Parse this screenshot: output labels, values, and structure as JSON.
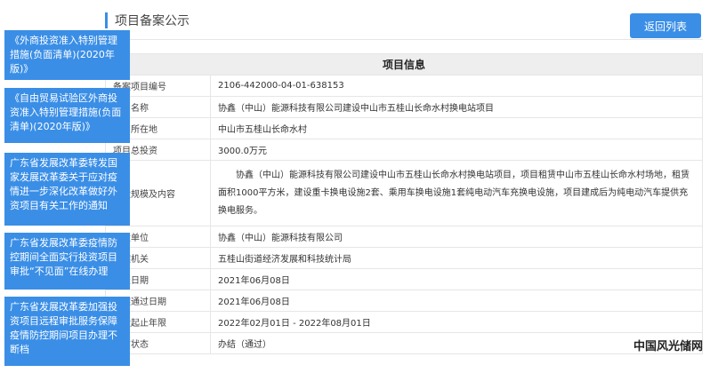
{
  "header": {
    "title": "项目备案公示"
  },
  "back_button": {
    "label": "返回列表"
  },
  "table": {
    "title": "项目信息",
    "rows": [
      {
        "label": "备案项目编号",
        "value": "2106-442000-04-01-638153"
      },
      {
        "label": "项目名称",
        "value": "协鑫（中山）能源科技有限公司建设中山市五桂山长命水村换电站项目"
      },
      {
        "label": "项目所在地",
        "value": "中山市五桂山长命水村"
      },
      {
        "label": "项目总投资",
        "value": "3000.0万元"
      },
      {
        "label": "建设规模及内容",
        "value": "协鑫（中山）能源科技有限公司建设中山市五桂山长命水村换电站项目，项目租赁中山市五桂山长命水村场地，租赁面积1000平方米，建设重卡换电设施2套、乘用车换电设施1套纯电动汽车充换电设施，项目建成后为纯电动汽车提供充换电服务。"
      },
      {
        "label": "建设单位",
        "value": "协鑫（中山）能源科技有限公司"
      },
      {
        "label": "备案机关",
        "value": "五桂山街道经济发展和科技统计局"
      },
      {
        "label": "申报日期",
        "value": "2021年06月08日"
      },
      {
        "label": "备案通过日期",
        "value": "2021年06月08日"
      },
      {
        "label": "建设起止年限",
        "value": "2022年02月01日 - 2022年08月01日"
      },
      {
        "label": "当前状态",
        "value": "办结（通过）"
      }
    ]
  },
  "sidebar": {
    "items": [
      {
        "label": "《外商投资准入特别管理措施(负面清单)(2020年版)》"
      },
      {
        "label": "《自由贸易试验区外商投资准入特别管理措施(负面清单)(2020年版)》"
      },
      {
        "label": "广东省发展改革委转发国家发展改革委关于应对疫情进一步深化改革做好外资项目有关工作的通知"
      },
      {
        "label": "广东省发展改革委疫情防控期间全面实行投资项目审批“不见面”在线办理"
      },
      {
        "label": "广东省发展改革委加强投资项目远程审批服务保障疫情防控期间项目办理不断档"
      }
    ]
  },
  "watermark": {
    "text": "中国风光储网"
  },
  "colors": {
    "accent": "#3a8ee6",
    "header_bg": "#eeeeee"
  }
}
